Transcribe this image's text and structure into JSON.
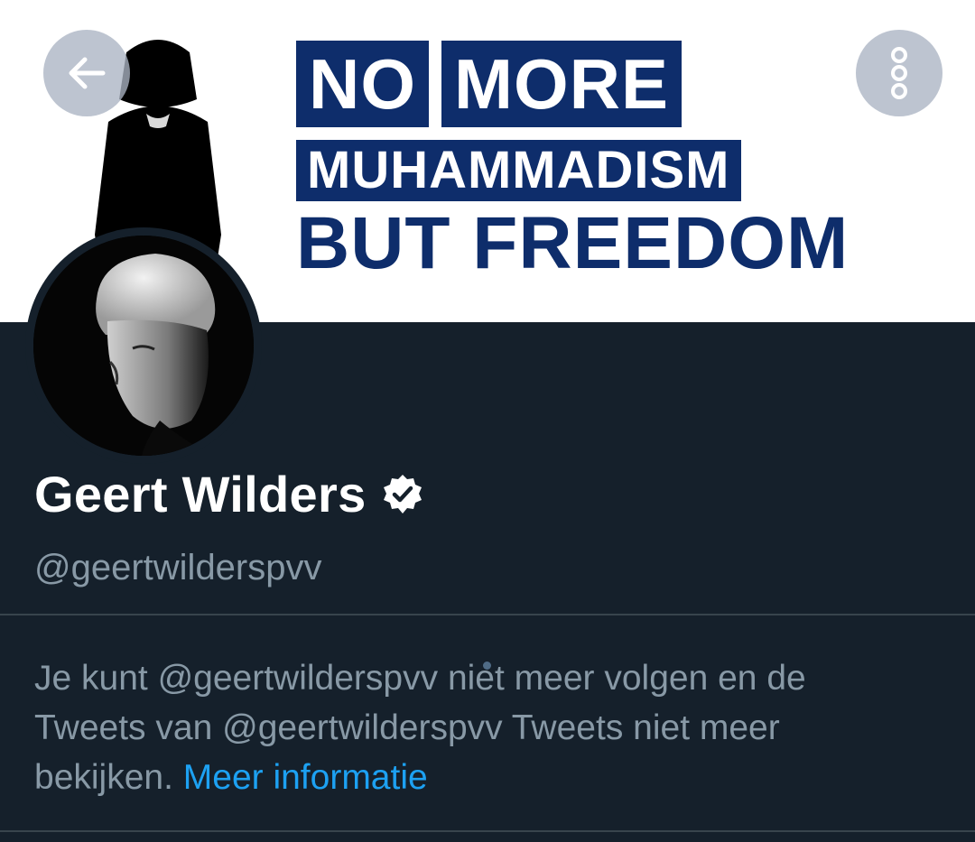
{
  "header": {
    "back_icon": "arrow-left-icon",
    "more_icon": "more-vertical-icon"
  },
  "banner": {
    "line1_word1": "NO",
    "line1_word2": "MORE",
    "line2": "MUHAMMADISM",
    "line3": "BUT FREEDOM",
    "brand_color": "#0e2d6b"
  },
  "profile": {
    "name": "Geert Wilders",
    "verified_icon": "verified-badge-icon",
    "handle": "@geertwilderspvv"
  },
  "notice": {
    "text": "Je kunt @geertwilderspvv niet meer volgen en de Tweets van @geertwilderspvv Tweets niet meer bekijken. ",
    "link_label": "Meer informatie",
    "link_color": "#1da1f2"
  },
  "colors": {
    "background": "#15202b",
    "secondary_text": "#8899a6",
    "divider": "#38444d"
  }
}
